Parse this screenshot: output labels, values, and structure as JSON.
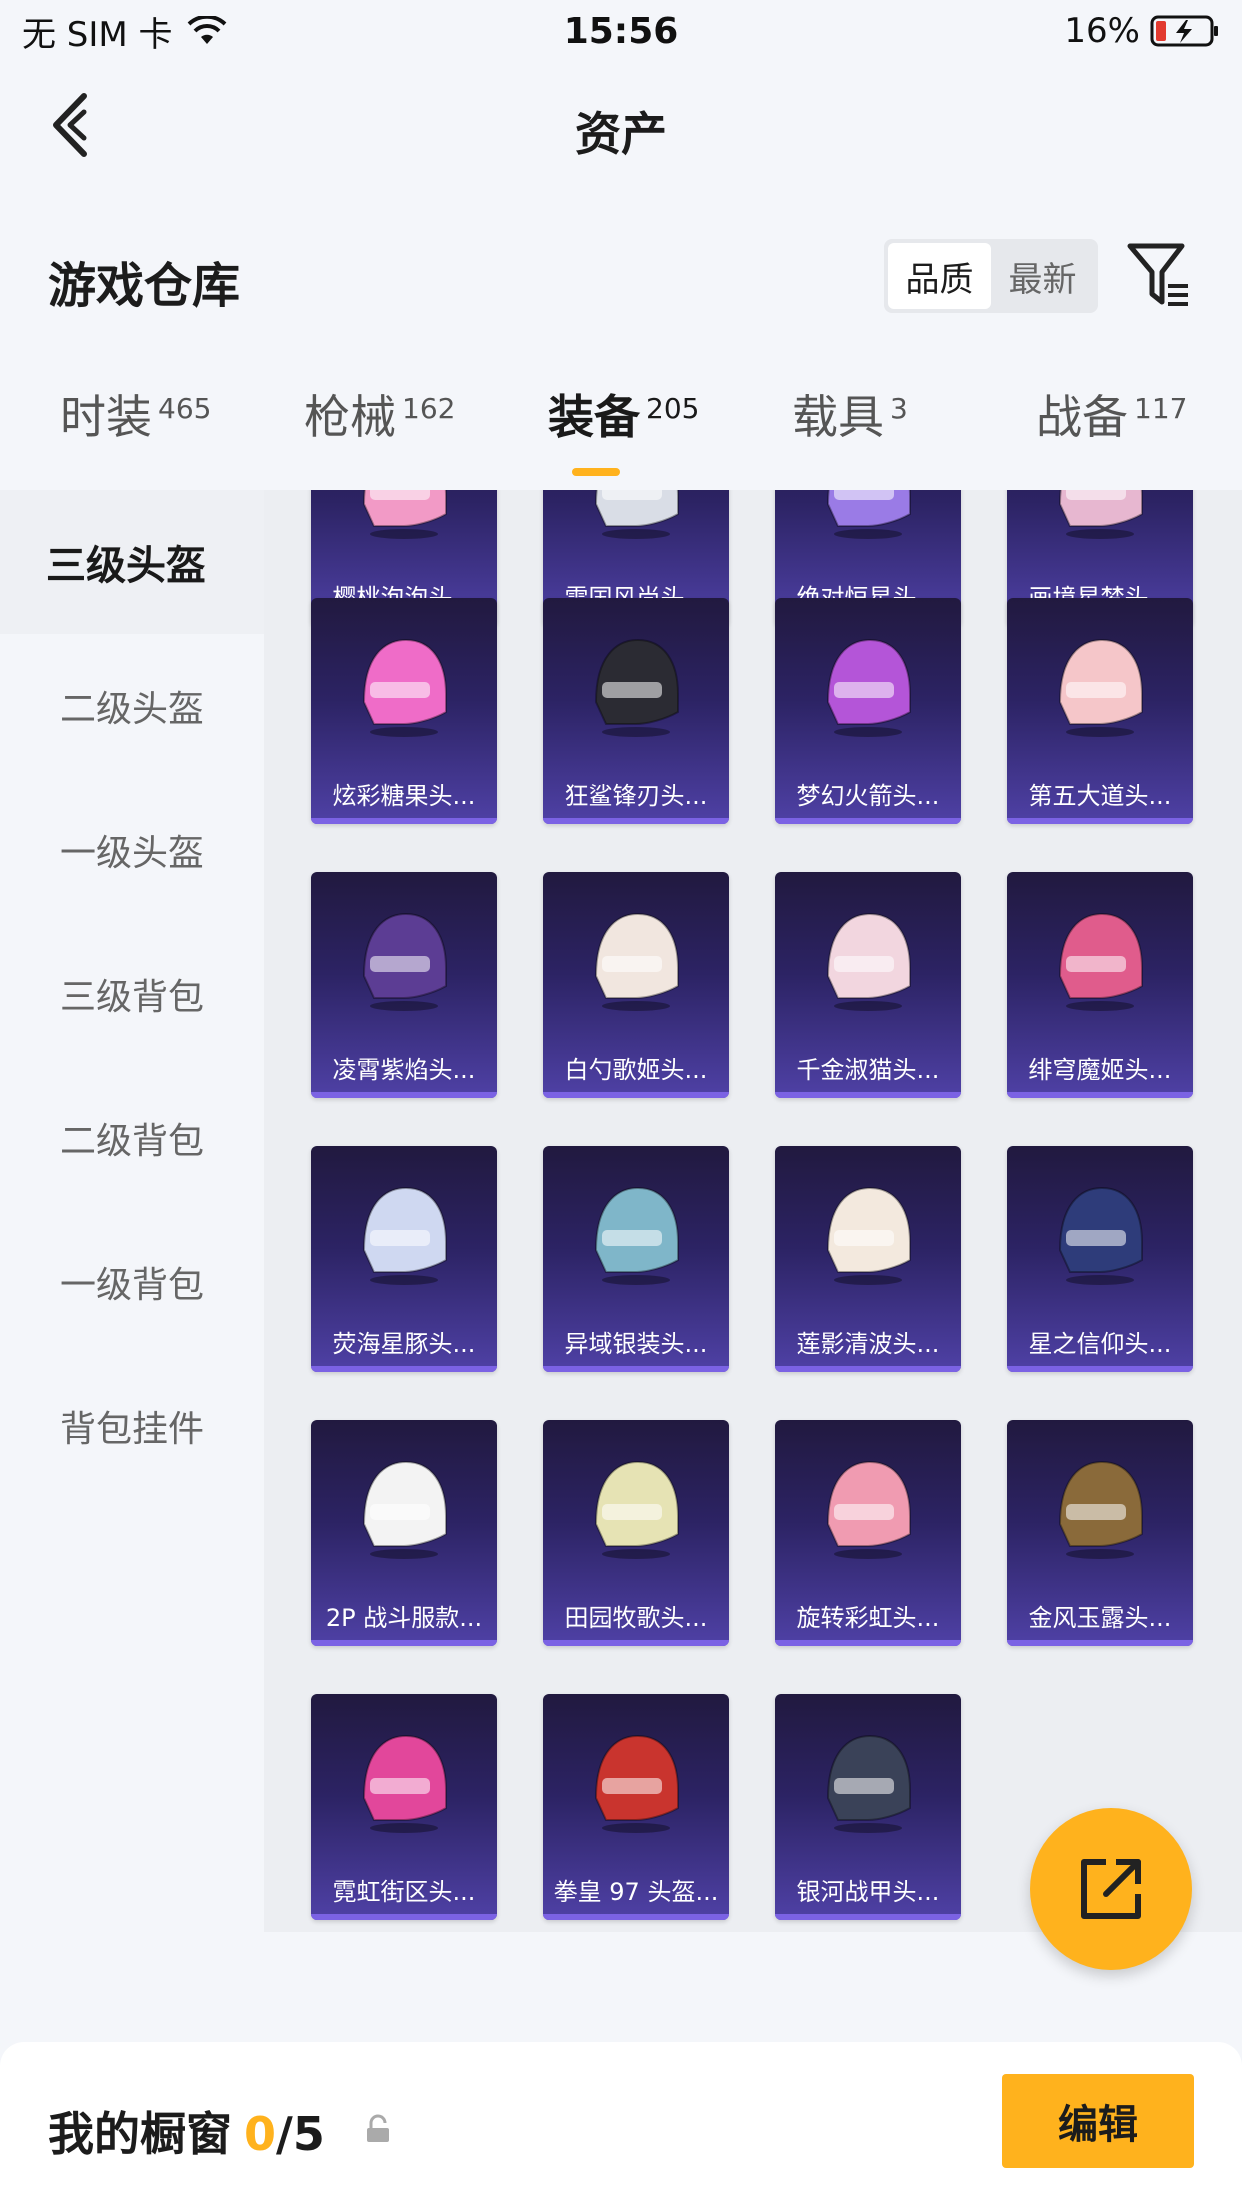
{
  "status_bar": {
    "carrier": "无 SIM 卡",
    "time": "15:56",
    "battery": "16%"
  },
  "nav": {
    "title": "资产"
  },
  "warehouse": {
    "title": "游戏仓库",
    "sort_options": [
      "品质",
      "最新"
    ],
    "active_sort": "品质"
  },
  "tabs": [
    {
      "label": "时装",
      "count": "465"
    },
    {
      "label": "枪械",
      "count": "162"
    },
    {
      "label": "装备",
      "count": "205"
    },
    {
      "label": "载具",
      "count": "3"
    },
    {
      "label": "战备",
      "count": "117"
    }
  ],
  "active_tab": "装备",
  "side_nav": [
    {
      "label": "三级头盔"
    },
    {
      "label": "二级头盔"
    },
    {
      "label": "一级头盔"
    },
    {
      "label": "三级背包"
    },
    {
      "label": "二级背包"
    },
    {
      "label": "一级背包"
    },
    {
      "label": "背包挂件"
    }
  ],
  "items": [
    {
      "name": "樱桃泡泡头...",
      "color": "#f29ac6"
    },
    {
      "name": "雪国风尚头...",
      "color": "#d9dde6"
    },
    {
      "name": "绝对恒星头...",
      "color": "#9a7be6"
    },
    {
      "name": "画境星梦头...",
      "color": "#e7b7d0"
    },
    {
      "name": "炫彩糖果头...",
      "color": "#ef6cc8"
    },
    {
      "name": "狂鲨锋刃头...",
      "color": "#2b2b33"
    },
    {
      "name": "梦幻火箭头...",
      "color": "#b455d8"
    },
    {
      "name": "第五大道头...",
      "color": "#f5c6c9"
    },
    {
      "name": "凌霄紫焰头...",
      "color": "#5c3d94"
    },
    {
      "name": "白勺歌姬头...",
      "color": "#f1e6df"
    },
    {
      "name": "千金淑猫头...",
      "color": "#f2d6df"
    },
    {
      "name": "绯穹魔姬头...",
      "color": "#e05c8c"
    },
    {
      "name": "荧海星豚头...",
      "color": "#cfd8f1"
    },
    {
      "name": "异域银装头...",
      "color": "#7fb6c9"
    },
    {
      "name": "莲影清波头...",
      "color": "#f3e9de"
    },
    {
      "name": "星之信仰头...",
      "color": "#2e3c7a"
    },
    {
      "name": "2P 战斗服款...",
      "color": "#f3f3f3"
    },
    {
      "name": "田园牧歌头...",
      "color": "#e6e3b4"
    },
    {
      "name": "旋转彩虹头...",
      "color": "#f09bb1"
    },
    {
      "name": "金风玉露头...",
      "color": "#8a6a3a"
    },
    {
      "name": "霓虹街区头...",
      "color": "#e2479b"
    },
    {
      "name": "拳皇 97 头盔...",
      "color": "#c9342e"
    },
    {
      "name": "银河战甲头...",
      "color": "#3a4258"
    }
  ],
  "footer": {
    "title": "我的橱窗",
    "count": "0",
    "total": "/5",
    "edit_label": "编辑"
  },
  "colors": {
    "accent": "#ffb21d",
    "card_dark": "#21193f",
    "card_light": "#4f41a6"
  },
  "icons": [
    "wifi-icon",
    "battery-icon",
    "back-chevron-icon",
    "filter-icon",
    "share-icon",
    "lock-icon"
  ]
}
